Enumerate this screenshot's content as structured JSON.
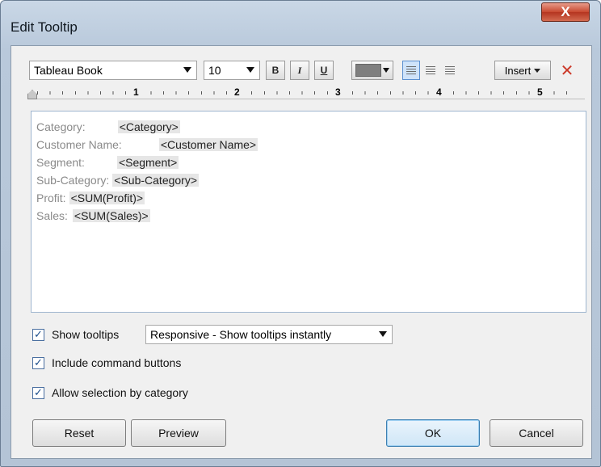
{
  "window": {
    "title": "Edit Tooltip",
    "close_label": "X"
  },
  "toolbar": {
    "font": "Tableau Book",
    "size": "10",
    "bold": "B",
    "italic": "I",
    "underline": "U",
    "text_color": "#7f7f7f",
    "insert_label": "Insert",
    "clear_symbol": "✕"
  },
  "ruler": {
    "marks": [
      "1",
      "2",
      "3",
      "4",
      "5"
    ]
  },
  "editor": {
    "lines": [
      {
        "label": "Category:",
        "token": "<Category>"
      },
      {
        "label": "Customer Name:",
        "token": "<Customer Name>"
      },
      {
        "label": "Segment:",
        "token": "<Segment>"
      },
      {
        "label": "Sub-Category:",
        "token": "<Sub-Category>"
      },
      {
        "label": "Profit:",
        "token": "<SUM(Profit)>"
      },
      {
        "label": "Sales:",
        "token": "<SUM(Sales)>"
      }
    ]
  },
  "options": {
    "show_tooltips": {
      "label": "Show tooltips",
      "checked": true
    },
    "mode": "Responsive - Show tooltips instantly",
    "include_buttons": {
      "label": "Include command buttons",
      "checked": true
    },
    "allow_selection": {
      "label": "Allow selection by category",
      "checked": true
    }
  },
  "buttons": {
    "reset": "Reset",
    "preview": "Preview",
    "ok": "OK",
    "cancel": "Cancel"
  }
}
